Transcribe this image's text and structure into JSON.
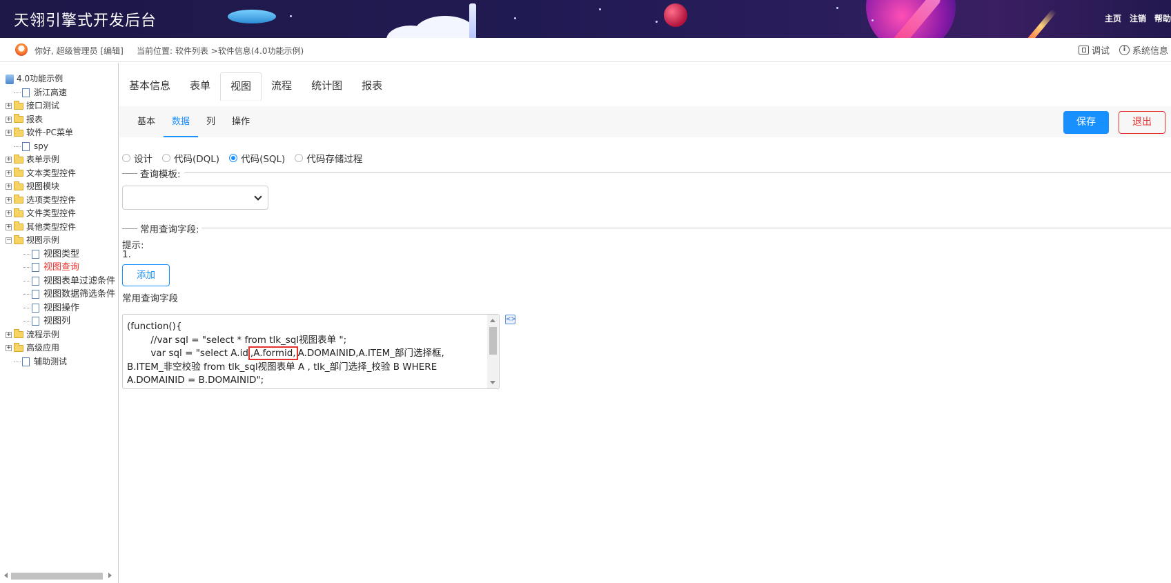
{
  "header": {
    "title": "天翎引擎式开发后台",
    "nav": [
      "主页",
      "注销",
      "帮助"
    ]
  },
  "infobar": {
    "greeting": "你好, 超级管理员 [编辑]",
    "location": "当前位置: 软件列表 >软件信息(4.0功能示例)",
    "debug": "调试",
    "sysinfo": "系统信息"
  },
  "tree": {
    "root": "4.0功能示例",
    "items": [
      {
        "label": "浙江高速",
        "type": "page",
        "level": 1
      },
      {
        "label": "接口测试",
        "type": "folder",
        "level": 0
      },
      {
        "label": "报表",
        "type": "folder",
        "level": 0
      },
      {
        "label": "软件-PC菜单",
        "type": "folder",
        "level": 0
      },
      {
        "label": "spy",
        "type": "page",
        "level": 1
      },
      {
        "label": "表单示例",
        "type": "folder",
        "level": 0
      },
      {
        "label": "文本类型控件",
        "type": "folder",
        "level": 0
      },
      {
        "label": "视图模块",
        "type": "folder",
        "level": 0
      },
      {
        "label": "选项类型控件",
        "type": "folder",
        "level": 0
      },
      {
        "label": "文件类型控件",
        "type": "folder",
        "level": 0
      },
      {
        "label": "其他类型控件",
        "type": "folder",
        "level": 0
      },
      {
        "label": "视图示例",
        "type": "folder-open",
        "level": 0
      },
      {
        "label": "视图类型",
        "type": "page",
        "level": 2
      },
      {
        "label": "视图查询",
        "type": "page",
        "level": 2,
        "active": true
      },
      {
        "label": "视图表单过滤条件",
        "type": "page",
        "level": 2
      },
      {
        "label": "视图数据筛选条件",
        "type": "page",
        "level": 2
      },
      {
        "label": "视图操作",
        "type": "page",
        "level": 2
      },
      {
        "label": "视图列",
        "type": "page",
        "level": 2
      },
      {
        "label": "流程示例",
        "type": "folder",
        "level": 0
      },
      {
        "label": "高级应用",
        "type": "folder",
        "level": 0
      },
      {
        "label": "辅助测试",
        "type": "page",
        "level": 1
      }
    ]
  },
  "tabs": [
    "基本信息",
    "表单",
    "视图",
    "流程",
    "统计图",
    "报表"
  ],
  "active_tab": "视图",
  "subtabs": [
    "基本",
    "数据",
    "列",
    "操作"
  ],
  "active_subtab": "数据",
  "buttons": {
    "save": "保存",
    "exit": "退出",
    "add": "添加"
  },
  "radios": [
    {
      "label": "设计",
      "checked": false
    },
    {
      "label": "代码(DQL)",
      "checked": false
    },
    {
      "label": "代码(SQL)",
      "checked": true
    },
    {
      "label": "代码存储过程",
      "checked": false
    }
  ],
  "query_template_legend": "查询模板:",
  "query_template_value": "",
  "common_fields_legend": "常用查询字段:",
  "tip_label": "提示:",
  "tip_item": "1.",
  "common_fields_label": "常用查询字段",
  "code": {
    "line1": "(function(){",
    "line2": "\t//var sql = \"select * from tlk_sql视图表单 \";",
    "line3_pre": "\tvar sql = \"select A.id",
    "line3_hl": ",A.formid,",
    "line3_post": "A.DOMAINID,A.ITEM_部门选择框,",
    "line4": "B.ITEM_非空校验 from tlk_sql视图表单 A , tlk_部门选择_校验 B WHERE",
    "line5": "A.DOMAINID = B.DOMAINID\";"
  },
  "colors": {
    "accent": "#1890ff",
    "danger": "#e5312c",
    "banner": "#1e1848"
  }
}
